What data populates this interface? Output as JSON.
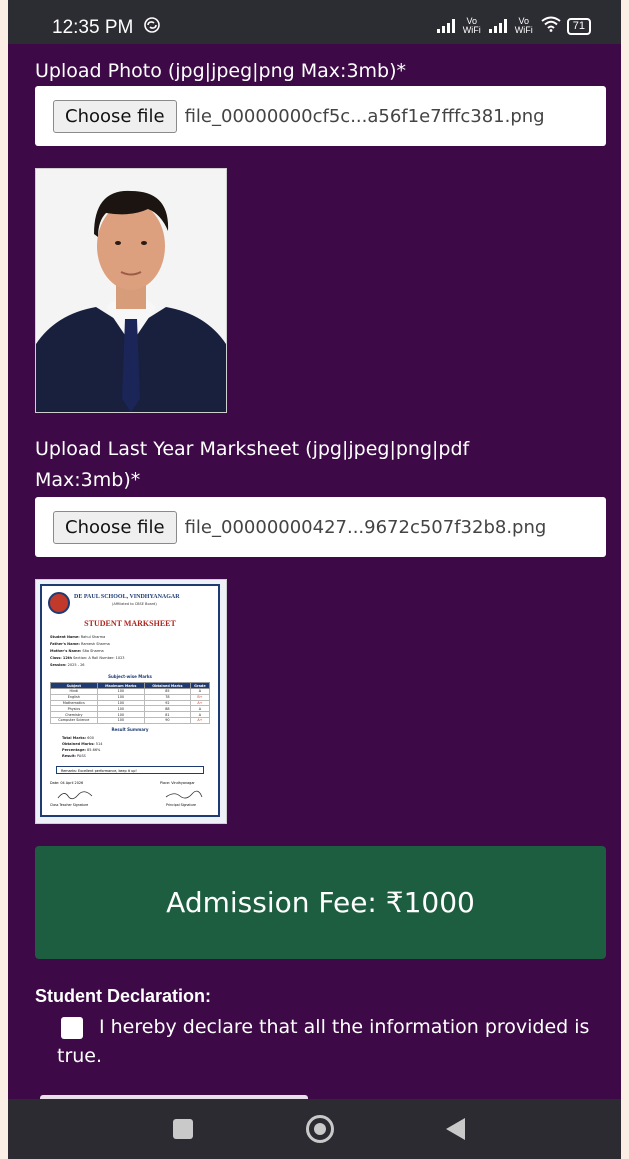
{
  "status_bar": {
    "time": "12:35 PM",
    "battery": "71",
    "vo_wifi_1": "Vo WiFi",
    "vo_wifi_2": "Vo WiFi"
  },
  "photo": {
    "label": "Upload Photo (jpg|jpeg|png Max:3mb)*",
    "button": "Choose file",
    "file_name": "file_00000000cf5c...a56f1e7fffc381.png"
  },
  "marksheet": {
    "label": "Upload Last Year Marksheet (jpg|jpeg|png|pdf Max:3mb)*",
    "button": "Choose file",
    "file_name": "file_00000000427...9672c507f32b8.png",
    "school": "DE PAUL SCHOOL, VINDHYANAGAR",
    "subtitle": "(Affiliated to CBSE Board)",
    "heading": "STUDENT MARKSHEET",
    "info": [
      {
        "k": "Student Name:",
        "v": "Rahul Sharma"
      },
      {
        "k": "Father's Name:",
        "v": "Ramesh Sharma"
      },
      {
        "k": "Mother's Name:",
        "v": "Sita Sharma"
      },
      {
        "k": "Class: 12th",
        "v": "Section: A   Roll Number: 1023"
      },
      {
        "k": "Session:",
        "v": "2025 - 26"
      }
    ],
    "marks_title": "Subject-wise Marks",
    "columns": [
      "Subject",
      "Maximum Marks",
      "Obtained Marks",
      "Grade"
    ],
    "rows": [
      [
        "Hindi",
        "100",
        "85",
        "A"
      ],
      [
        "English",
        "100",
        "78",
        "B+"
      ],
      [
        "Mathematics",
        "100",
        "92",
        "A+"
      ],
      [
        "Physics",
        "100",
        "88",
        "A"
      ],
      [
        "Chemistry",
        "100",
        "81",
        "A"
      ],
      [
        "Computer Science",
        "100",
        "90",
        "A+"
      ]
    ],
    "summary_title": "Result Summary",
    "summary": [
      {
        "k": "Total Marks:",
        "v": "600"
      },
      {
        "k": "Obtained Marks:",
        "v": "514"
      },
      {
        "k": "Percentage:",
        "v": "85.66%"
      },
      {
        "k": "Result:",
        "v": "PASS"
      }
    ],
    "remarks": "Remarks: Excellent performance, keep it up!",
    "date": "Date: 04 April 2026",
    "place": "Place: Vindhyanagar",
    "sign_left": "Class Teacher Signature",
    "sign_right": "Principal Signature"
  },
  "fee": {
    "label": "Admission Fee: ₹1000"
  },
  "declaration": {
    "title": "Student Declaration:",
    "text": "I hereby declare that all the information provided is true."
  },
  "colors": {
    "background": "#3d0a47",
    "fee_button": "#1c5e3f"
  }
}
